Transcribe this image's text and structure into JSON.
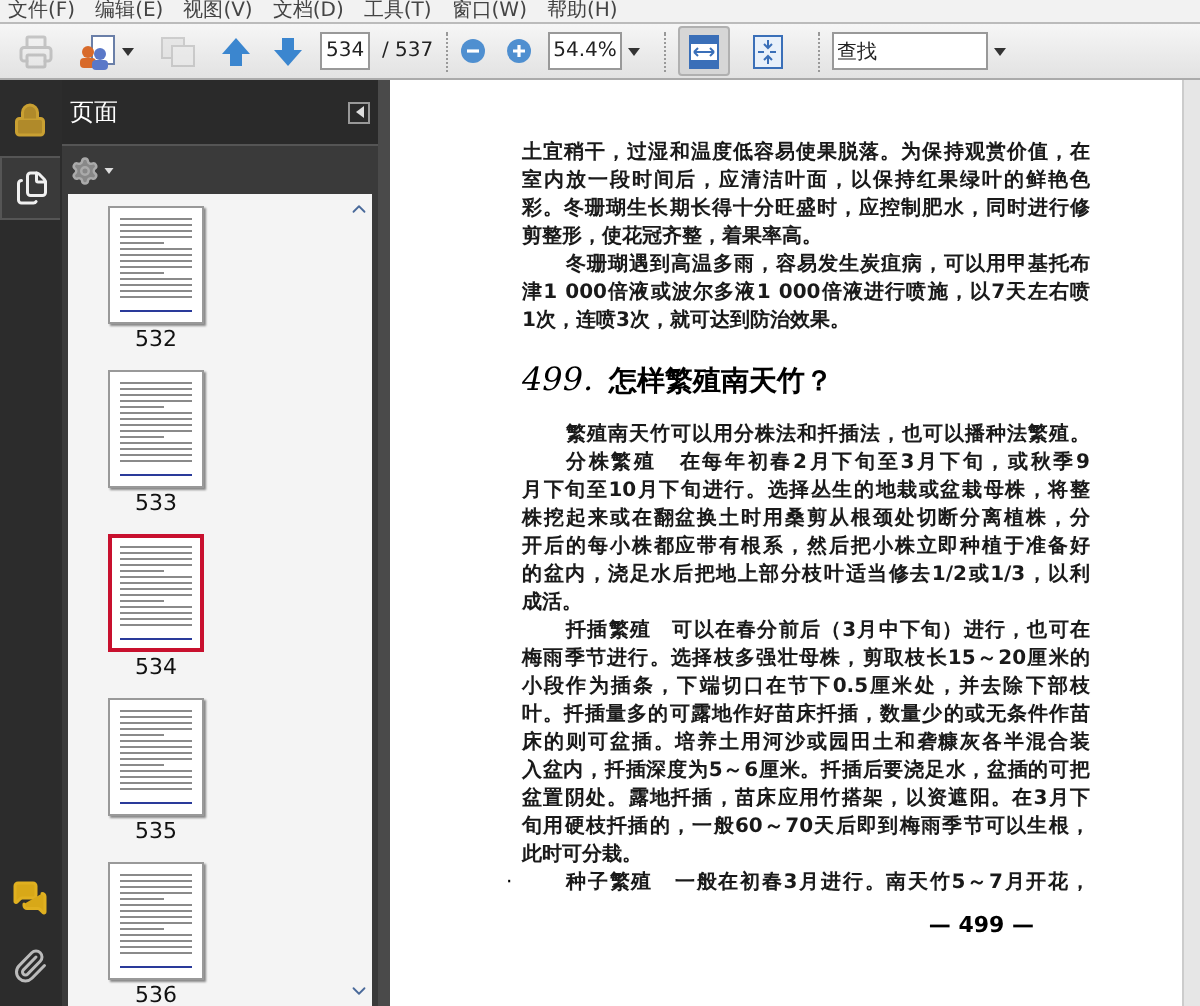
{
  "menu": [
    "文件(F)",
    "编辑(E)",
    "视图(V)",
    "文档(D)",
    "工具(T)",
    "窗口(W)",
    "帮助(H)"
  ],
  "toolbar": {
    "buttons": [
      {
        "kind": "print",
        "disabled": true
      },
      {
        "kind": "share",
        "disabled": false
      },
      {
        "kind": "review",
        "disabled": true
      }
    ],
    "page_field": {
      "value": "534"
    },
    "page_total": "/ 537",
    "zoom_field": {
      "value": "54.4%"
    },
    "view_buttons": [
      {
        "kind": "fit-width",
        "selected": true
      },
      {
        "kind": "fit-page",
        "selected": false
      }
    ],
    "search_field": {
      "value": "查找"
    }
  },
  "side_tabs": [
    {
      "kind": "security",
      "selected": false
    },
    {
      "kind": "pages",
      "selected": true
    },
    {
      "kind": "comments",
      "selected": false
    },
    {
      "kind": "attachments",
      "selected": false
    }
  ],
  "panel": {
    "title": "页面",
    "thumbnails": [
      {
        "label": "532",
        "selected": false
      },
      {
        "label": "533",
        "selected": false
      },
      {
        "label": "534",
        "selected": true
      },
      {
        "label": "535",
        "selected": false
      },
      {
        "label": "536",
        "selected": false
      }
    ]
  },
  "document": {
    "blocks": [
      {
        "kind": "paragraph",
        "indent": false,
        "lines": [
          "土宜稍干，过湿和温度低容易使果脱落。为保持观赏价值，在",
          "室内放一段时间后，应清洁叶面，以保持红果绿叶的鲜艳色",
          "彩。冬珊瑚生长期长得十分旺盛时，应控制肥水，同时进行修",
          "剪整形，使花冠齐整，着果率高。"
        ]
      },
      {
        "kind": "paragraph",
        "indent": true,
        "lines": [
          "冬珊瑚遇到高温多雨，容易发生炭疽病，可以用甲基托布",
          "津1 000倍液或波尔多液1 000倍液进行喷施，以7天左右喷",
          "1次，连喷3次，就可达到防治效果。"
        ]
      },
      {
        "kind": "heading",
        "number": "499.",
        "title": "怎样繁殖南天竹？"
      },
      {
        "kind": "paragraph",
        "indent": true,
        "lines": [
          "繁殖南天竹可以用分株法和扦插法，也可以播种法繁殖。"
        ]
      },
      {
        "kind": "paragraph",
        "indent": true,
        "lines": [
          "分株繁殖　在每年初春2月下旬至3月下旬，或秋季9",
          "月下旬至10月下旬进行。选择丛生的地栽或盆栽母株，将整",
          "株挖起来或在翻盆换土时用桑剪从根颈处切断分离植株，分",
          "开后的每小株都应带有根系，然后把小株立即种植于准备好",
          "的盆内，浇足水后把地上部分枝叶适当修去1/2或1/3，以利",
          "成活。"
        ]
      },
      {
        "kind": "paragraph",
        "indent": true,
        "lines": [
          "扦插繁殖　可以在春分前后（3月中下旬）进行，也可在",
          "梅雨季节进行。选择枝多强壮母株，剪取枝长15～20厘米的",
          "小段作为插条，下端切口在节下0.5厘米处，并去除下部枝",
          "叶。扦插量多的可露地作好苗床扦插，数量少的或无条件作苗",
          "床的则可盆插。培养土用河沙或园田土和砻糠灰各半混合装",
          "入盆内，扦插深度为5～6厘米。扦插后要浇足水，盆插的可把",
          "盆置阴处。露地扦插，苗床应用竹搭架，以资遮阳。在3月下",
          "旬用硬枝扦插的，一般60～70天后即到梅雨季节可以生根，",
          "此时可分栽。"
        ]
      },
      {
        "kind": "paragraph",
        "indent": true,
        "margin_mark": "·",
        "lines": [
          "种子繁殖　一般在初春3月进行。南天竹5～7月开花，"
        ]
      },
      {
        "kind": "footer",
        "text": "— 499 —"
      }
    ]
  }
}
